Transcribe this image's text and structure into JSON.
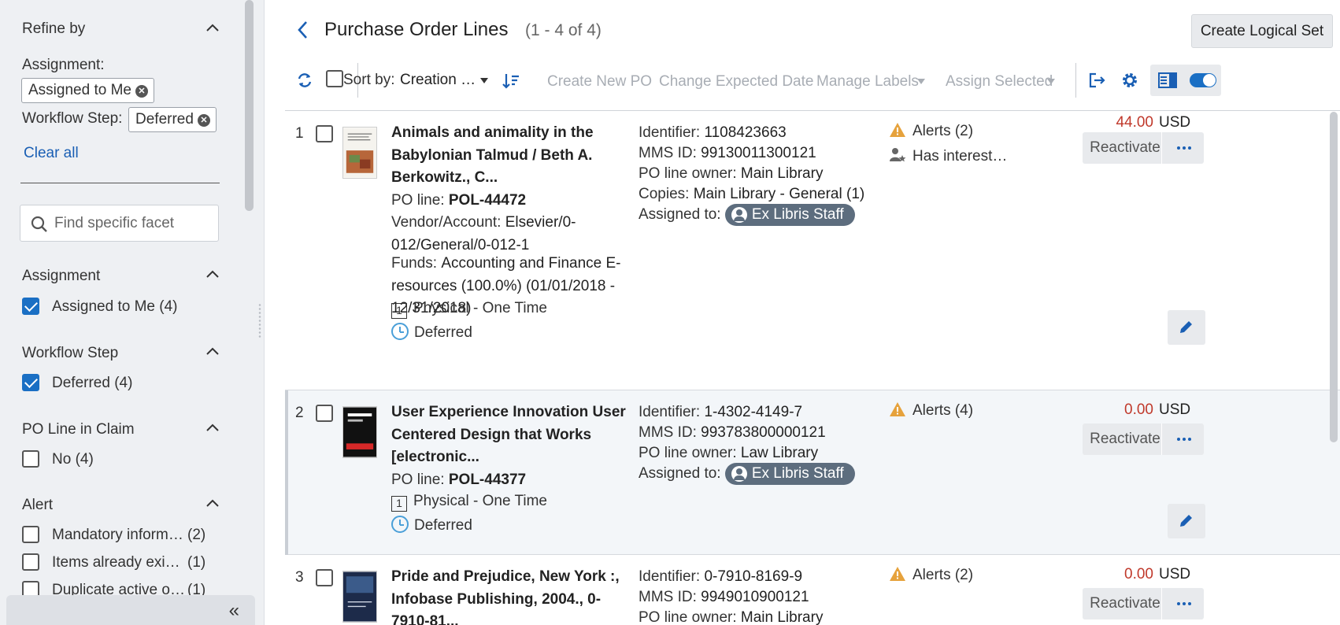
{
  "sidebar": {
    "refine_by": "Refine by",
    "assignment_label": "Assignment:",
    "assignment_chip": "Assigned to Me",
    "workflow_label": "Workflow Step:",
    "workflow_chip": "Deferred",
    "clear_all": "Clear all",
    "search_placeholder": "Find specific facet",
    "facets": {
      "assignment": {
        "title": "Assignment",
        "items": [
          {
            "label": "Assigned to Me",
            "count": "(4)",
            "checked": true
          }
        ]
      },
      "workflow": {
        "title": "Workflow Step",
        "items": [
          {
            "label": "Deferred",
            "count": "(4)",
            "checked": true
          }
        ]
      },
      "claim": {
        "title": "PO Line in Claim",
        "items": [
          {
            "label": "No",
            "count": "(4)",
            "checked": false
          }
        ]
      },
      "alert": {
        "title": "Alert",
        "items": [
          {
            "label": "Mandatory inform…",
            "count": "(2)",
            "checked": false
          },
          {
            "label": "Items already exi…",
            "count": "(1)",
            "checked": false
          },
          {
            "label": "Duplicate active o…",
            "count": "(1)",
            "checked": false
          }
        ]
      }
    },
    "collapse_icon": "«"
  },
  "header": {
    "title": "Purchase Order Lines",
    "count": "(1 - 4 of 4)",
    "create_logical_set": "Create Logical Set"
  },
  "toolbar": {
    "sort_by": "Sort by:",
    "sort_value": "Creation …",
    "create_new_po": "Create New PO",
    "change_expected_date": "Change Expected Date",
    "manage_labels": "Manage Labels",
    "assign_selected": "Assign Selected"
  },
  "rows": [
    {
      "num": "1",
      "title": "Animals and animality in the Babylonian Talmud / Beth A. Berkowitz., C...",
      "po_line_label": "PO line: ",
      "po_line": "POL-44472",
      "vendor_label": "Vendor/Account: ",
      "vendor": "Elsevier/0-012/General/0-012-1",
      "funds_label": "Funds: ",
      "funds": "Accounting and Finance E-resources (100.0%) (01/01/2018 - 12/31/2018)",
      "type_num": "1",
      "type": "Physical - One Time",
      "status": "Deferred",
      "identifier_label": "Identifier: ",
      "identifier": "1108423663",
      "mms_label": "MMS ID: ",
      "mms": "99130011300121",
      "owner_label": "PO line owner: ",
      "owner": "Main Library",
      "copies_label": "Copies: ",
      "copies": "Main Library - General (1)",
      "assigned_label": "Assigned to: ",
      "assigned": "Ex Libris Staff",
      "alerts": "Alerts (2)",
      "interest": "Has interest…",
      "price": "44.00",
      "currency": "USD",
      "reactivate": "Reactivate"
    },
    {
      "num": "2",
      "title": "User Experience Innovation User Centered Design that Works [electronic...",
      "po_line_label": "PO line: ",
      "po_line": "POL-44377",
      "type_num": "1",
      "type": "Physical - One Time",
      "status": "Deferred",
      "identifier_label": "Identifier: ",
      "identifier": "1-4302-4149-7",
      "mms_label": "MMS ID: ",
      "mms": "993783800000121",
      "owner_label": "PO line owner: ",
      "owner": "Law Library",
      "assigned_label": "Assigned to: ",
      "assigned": "Ex Libris Staff",
      "alerts": "Alerts (4)",
      "price": "0.00",
      "currency": "USD",
      "reactivate": "Reactivate"
    },
    {
      "num": "3",
      "title": "Pride and Prejudice, New York :, Infobase Publishing, 2004., 0-7910-81...",
      "identifier_label": "Identifier: ",
      "identifier": "0-7910-8169-9",
      "mms_label": "MMS ID: ",
      "mms": "9949010900121",
      "owner_label": "PO line owner: ",
      "owner": "Main Library",
      "alerts": "Alerts (2)",
      "price": "0.00",
      "currency": "USD",
      "reactivate": "Reactivate"
    }
  ],
  "colors": {
    "accent": "#1a6fc4",
    "price": "#c0392b",
    "pill": "#5d6d7e",
    "warning": "#e6a23c"
  }
}
